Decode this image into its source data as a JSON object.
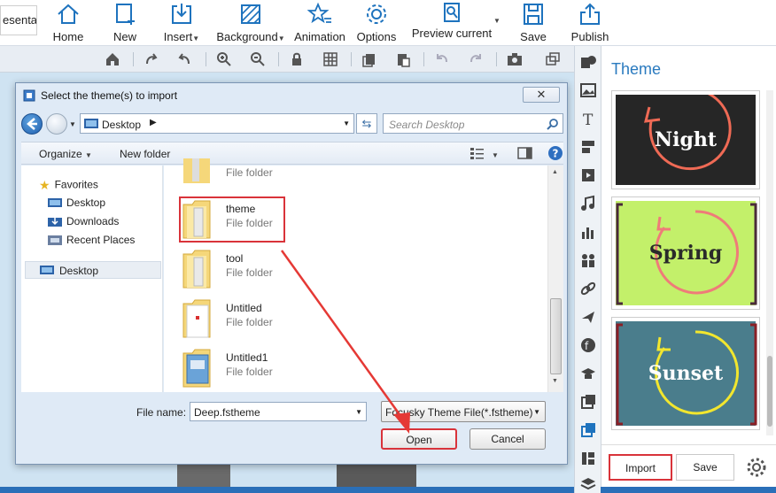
{
  "ribbon": {
    "partial_tab": "esenta",
    "buttons": [
      {
        "label": "Home"
      },
      {
        "label": "New"
      },
      {
        "label": "Insert"
      },
      {
        "label": "Background"
      },
      {
        "label": "Animation"
      },
      {
        "label": "Options"
      },
      {
        "label": "Preview current"
      },
      {
        "label": "Save"
      },
      {
        "label": "Publish"
      }
    ]
  },
  "theme_panel": {
    "title": "Theme",
    "themes": [
      {
        "name": "Night",
        "bg": "#262626",
        "ring": "#ef6a55",
        "text": "#ffffff"
      },
      {
        "name": "Spring",
        "bg": "#c3f06a",
        "ring": "#ef7b79",
        "text": "#2a2a2a",
        "bracket": "#4a2a3a"
      },
      {
        "name": "Sunset",
        "bg": "#4a7d8c",
        "ring": "#f2e62e",
        "text": "#ffffff",
        "bracket": "#8a1f26"
      }
    ],
    "import_label": "Import",
    "save_label": "Save"
  },
  "dialog": {
    "title": "Select the theme(s) to import",
    "address": "Desktop",
    "search_placeholder": "Search Desktop",
    "organize_label": "Organize",
    "new_folder_label": "New folder",
    "nav": {
      "favorites": "Favorites",
      "items": [
        "Desktop",
        "Downloads",
        "Recent Places"
      ],
      "selected": "Desktop"
    },
    "files": [
      {
        "name": "",
        "type": "File folder"
      },
      {
        "name": "theme",
        "type": "File folder"
      },
      {
        "name": "tool",
        "type": "File folder"
      },
      {
        "name": "Untitled",
        "type": "File folder"
      },
      {
        "name": "Untitled1",
        "type": "File folder"
      }
    ],
    "file_name_label": "File name:",
    "file_name_value": "Deep.fstheme",
    "filter_value": "Focusky Theme File(*.fstheme)",
    "open_label": "Open",
    "cancel_label": "Cancel"
  },
  "colors": {
    "accent": "#2a7abf",
    "highlight": "#d9333a"
  }
}
